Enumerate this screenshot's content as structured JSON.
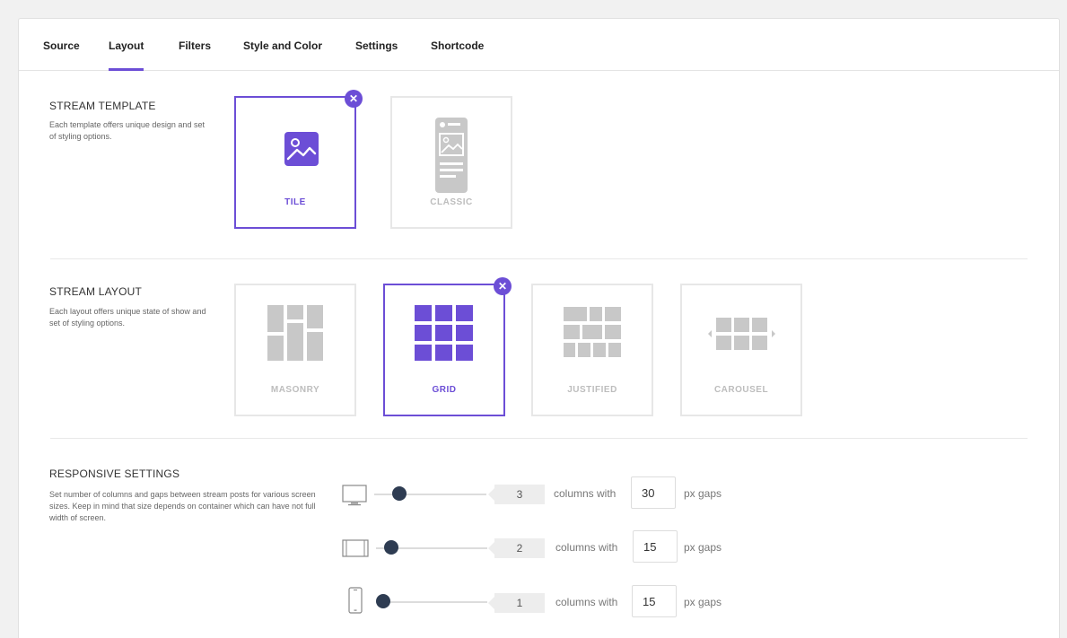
{
  "tabs": [
    {
      "label": "Source",
      "active": false
    },
    {
      "label": "Layout",
      "active": true
    },
    {
      "label": "Filters",
      "active": false
    },
    {
      "label": "Style and Color",
      "active": false
    },
    {
      "label": "Settings",
      "active": false
    },
    {
      "label": "Shortcode",
      "active": false
    }
  ],
  "colors": {
    "accent": "#6c4ed6",
    "knob": "#2e3c52",
    "inactive": "#c8c8c8"
  },
  "stream_template": {
    "title": "STREAM TEMPLATE",
    "description": "Each template offers unique design and set of styling options.",
    "options": [
      {
        "label": "TILE",
        "selected": true,
        "icon": "image-icon"
      },
      {
        "label": "CLASSIC",
        "selected": false,
        "icon": "classic-post-icon"
      }
    ]
  },
  "stream_layout": {
    "title": "STREAM LAYOUT",
    "description": "Each layout offers unique state of show and set of styling options.",
    "options": [
      {
        "label": "MASONRY",
        "selected": false,
        "icon": "masonry-icon"
      },
      {
        "label": "GRID",
        "selected": true,
        "icon": "grid-icon"
      },
      {
        "label": "JUSTIFIED",
        "selected": false,
        "icon": "justified-icon"
      },
      {
        "label": "CAROUSEL",
        "selected": false,
        "icon": "carousel-icon"
      }
    ]
  },
  "responsive": {
    "title": "RESPONSIVE SETTINGS",
    "description": "Set number of columns and gaps between stream posts for various screen sizes. Keep in mind that size depends on container which can have not full width of screen.",
    "columns_text": "columns with",
    "gaps_text": "px gaps",
    "rows": [
      {
        "device": "desktop-icon",
        "columns": "3",
        "gap": "30"
      },
      {
        "device": "tablet-icon",
        "columns": "2",
        "gap": "15"
      },
      {
        "device": "mobile-icon",
        "columns": "1",
        "gap": "15"
      }
    ]
  }
}
